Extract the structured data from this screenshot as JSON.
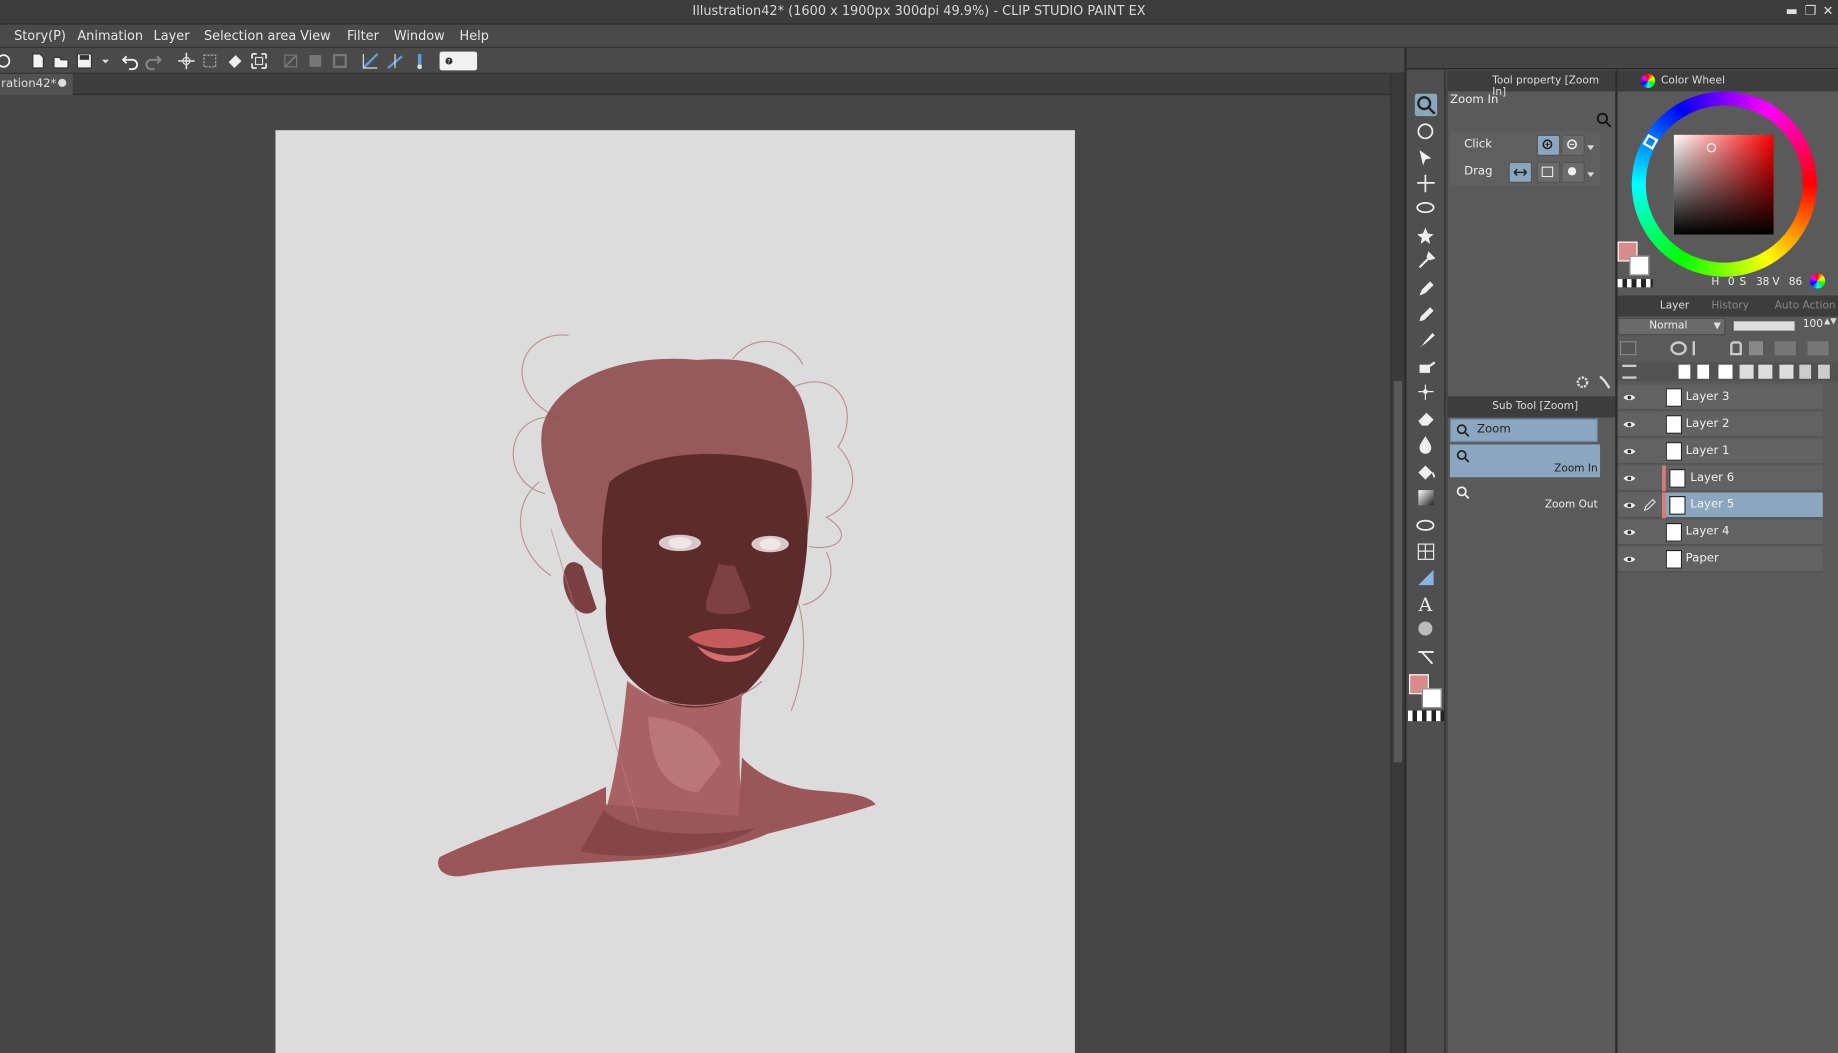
{
  "window": {
    "title": "Illustration42* (1600 x 1900px 300dpi 49.9%)  - CLIP STUDIO PAINT EX",
    "controls": [
      "minimize",
      "maximize",
      "close"
    ]
  },
  "menu": {
    "items": [
      "Story(P)",
      "Animation",
      "Layer",
      "Selection area",
      "View",
      "Filter",
      "Window",
      "Help"
    ]
  },
  "document_tab": {
    "label": "ration42*",
    "close": "●"
  },
  "tool_property": {
    "tab_label": "Tool property [Zoom In]",
    "section_title": "Zoom In",
    "click_label": "Click",
    "drag_label": "Drag"
  },
  "sub_tool": {
    "tab_label": "Sub Tool [Zoom]",
    "group": "Zoom",
    "items": [
      "Zoom In",
      "Zoom Out"
    ],
    "selected": "Zoom In"
  },
  "color_wheel": {
    "tab_label": "Color Wheel",
    "h_label": "H",
    "h_value": "0",
    "s_label": "S",
    "s_value": "38",
    "v_label": "V",
    "v_value": "86",
    "main_color": "#d98a8a",
    "sub_color": "#ffffff"
  },
  "layer_panel": {
    "tabs": [
      "Layer",
      "History",
      "Auto Action"
    ],
    "blend_mode": "Normal",
    "opacity": "100",
    "layers": [
      {
        "name": "Layer 3",
        "selected": false,
        "clip": false
      },
      {
        "name": "Layer 2",
        "selected": false,
        "clip": false
      },
      {
        "name": "Layer 1",
        "selected": false,
        "clip": false
      },
      {
        "name": "Layer 6",
        "selected": false,
        "clip": true
      },
      {
        "name": "Layer 5",
        "selected": true,
        "clip": true
      },
      {
        "name": "Layer 4",
        "selected": false,
        "clip": false
      },
      {
        "name": "Paper",
        "selected": false,
        "clip": false
      }
    ]
  },
  "colors": {
    "accent": "#8aa7bf",
    "skin_dark": "#7a3f40",
    "skin_mid": "#9b5758",
    "paper": "#dcdcdc"
  }
}
